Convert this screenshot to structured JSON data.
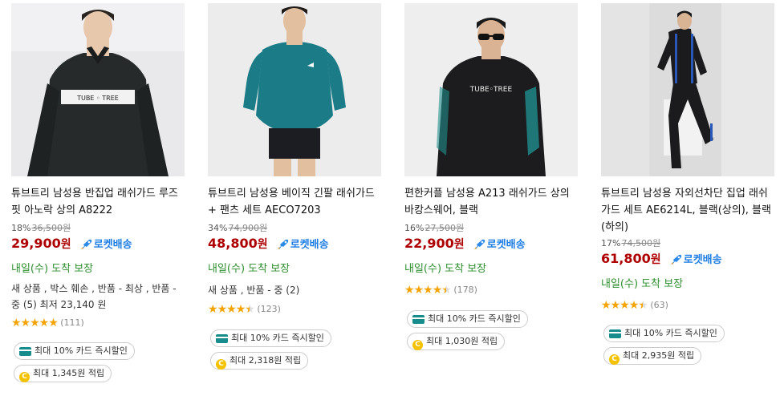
{
  "products": [
    {
      "title": "튜브트리 남성용 반집업 래쉬가드 루즈핏 아노락 상의 A8222",
      "discount": "18%",
      "original_price": "36,500원",
      "price": "29,900",
      "won": "원",
      "rocket_label": "로켓배송",
      "arrival": "내일(수) 도착 보장",
      "detail": "새 상품 , 박스 훼손 , 반품 - 최상 , 반품 - 중 (5) 최저 23,140 원",
      "stars": "★★★★★",
      "rating": 5,
      "review_count": "(111)",
      "card_discount": "최대 10% 카드 즉시할인",
      "reward": "최대 1,345원 적립",
      "image": {
        "bg": "#e9e9eb",
        "shirt": "#262a2b",
        "skin": "#e7c8ad",
        "hair": "#2a2420",
        "stripe": "#f2f2f2",
        "brand": "TUBE ◦ TREE"
      }
    },
    {
      "title": "튜브트리 남성용 베이직 긴팔 래쉬가드 + 팬츠 세트 AECO7203",
      "discount": "34%",
      "original_price": "74,900원",
      "price": "48,800",
      "won": "원",
      "rocket_label": "로켓배송",
      "arrival": "내일(수) 도착 보장",
      "detail": "새 상품 , 반품 - 중 (2)",
      "stars": "★★★★★",
      "rating": 4.5,
      "review_count": "(123)",
      "card_discount": "최대 10% 카드 즉시할인",
      "reward": "최대 2,318원 적립",
      "image": {
        "bg": "#eeeeee",
        "shirt": "#1b7b86",
        "skin": "#e2bf9f",
        "hair": "#1e1a18",
        "shorts": "#1c1d22"
      }
    },
    {
      "title": "편한커플 남성용 A213 래쉬가드 상의 바캉스웨어, 블랙",
      "discount": "16%",
      "original_price": "27,500원",
      "price": "22,900",
      "won": "원",
      "rocket_label": "로켓배송",
      "arrival": "내일(수) 도착 보장",
      "stars": "★★★★★",
      "rating": 4.5,
      "review_count": "(178)",
      "card_discount": "최대 10% 카드 즉시할인",
      "reward": "최대 1,030원 적립",
      "image": {
        "bg": "#eeeeee",
        "shirt": "#1c1c1e",
        "skin": "#d9b394",
        "hair": "#1a1a1a",
        "accent": "#1f8f8c",
        "brand": "TUBE◦TREE"
      }
    },
    {
      "title": "튜브트리 남성용 자외선차단 집업 래쉬가드 세트 AE6214L, 블랙(상의), 블랙(하의)",
      "discount": "17%",
      "original_price": "74,500원",
      "price": "61,800",
      "won": "원",
      "rocket_label": "로켓배송",
      "arrival": "내일(수) 도착 보장",
      "stars": "★★★★★",
      "rating": 4.5,
      "review_count": "(63)",
      "card_discount": "최대 10% 카드 즉시할인",
      "reward": "최대 2,935원 적립",
      "image": {
        "bg": "#dcdcdc",
        "shirt": "#1b1b1d",
        "skin": "#d8b394",
        "accent": "#2a58b8",
        "box": "#f2f2f2"
      }
    }
  ],
  "colors": {
    "price": "#ae0000",
    "rocket": "#1e7ee4",
    "arrival": "#2d8f2d",
    "star": "#f5a300",
    "card_icon": "#168c8c",
    "coin": "#f4c200"
  }
}
